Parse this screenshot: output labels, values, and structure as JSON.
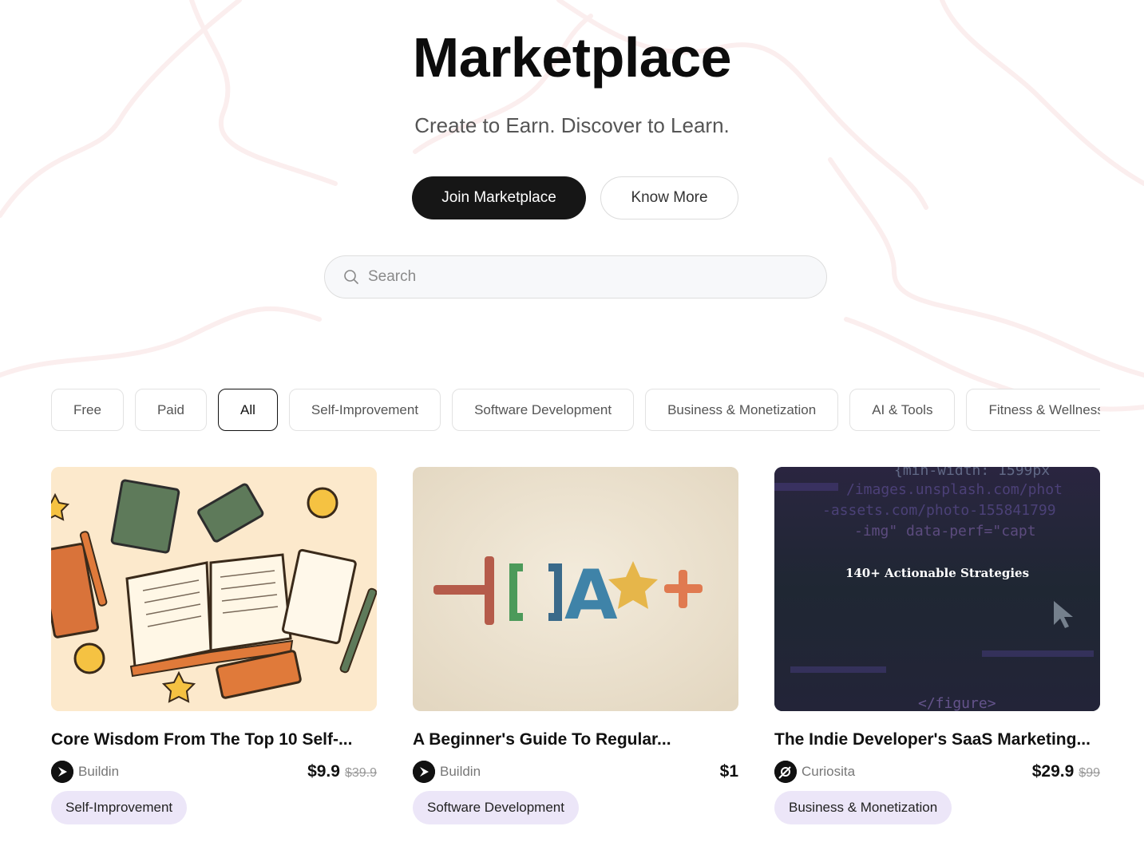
{
  "hero": {
    "title": "Marketplace",
    "subtitle": "Create to Earn. Discover to Learn.",
    "primary_button": "Join Marketplace",
    "secondary_button": "Know More"
  },
  "search": {
    "placeholder": "Search",
    "icon": "search-icon"
  },
  "filters": [
    {
      "label": "Free",
      "active": false
    },
    {
      "label": "Paid",
      "active": false
    },
    {
      "label": "All",
      "active": true
    },
    {
      "label": "Self-Improvement",
      "active": false
    },
    {
      "label": "Software Development",
      "active": false
    },
    {
      "label": "Business & Monetization",
      "active": false
    },
    {
      "label": "AI & Tools",
      "active": false
    },
    {
      "label": "Fitness & Wellness",
      "active": false
    }
  ],
  "cards": [
    {
      "title": "Core Wisdom From The Top 10 Self-...",
      "author": "Buildin",
      "price": "$9.9",
      "old_price": "$39.9",
      "tag": "Self-Improvement",
      "image": "books-illustration"
    },
    {
      "title": "A Beginner's Guide To Regular...",
      "author": "Buildin",
      "price": "$1",
      "old_price": "",
      "tag": "Software Development",
      "image": "regex-symbols",
      "image_text": "[ ]A"
    },
    {
      "title": "The Indie Developer's SaaS Marketing...",
      "author": "Curiosita",
      "price": "$29.9",
      "old_price": "$99",
      "tag": "Business & Monetization",
      "image": "code-screen",
      "image_text": "140+ Actionable Strategies"
    }
  ],
  "colors": {
    "primary_button_bg": "#161616",
    "tag_bg": "#ece6f8",
    "background": "#ffffff"
  }
}
